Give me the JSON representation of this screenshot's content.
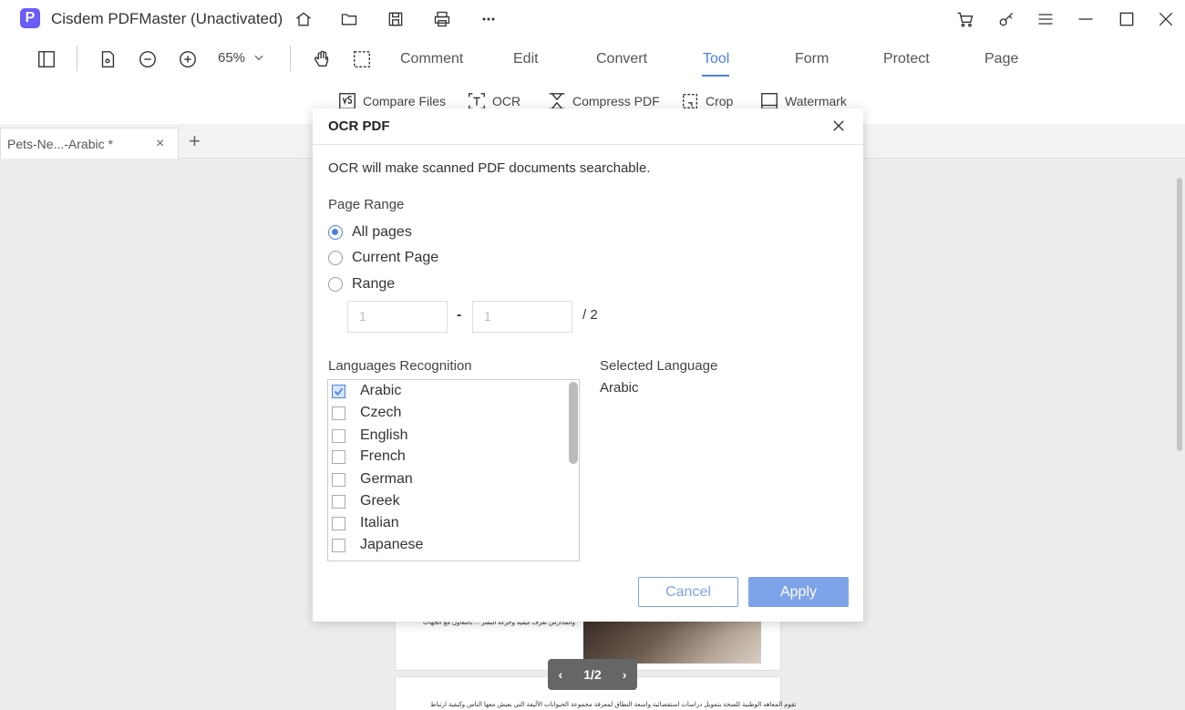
{
  "app": {
    "logo_letter": "P",
    "title": "Cisdem PDFMaster (Unactivated)"
  },
  "toolbar": {
    "zoom": "65%",
    "tabs": [
      {
        "label": "Comment"
      },
      {
        "label": "Edit"
      },
      {
        "label": "Convert"
      },
      {
        "label": "Tool"
      },
      {
        "label": "Form"
      },
      {
        "label": "Protect"
      },
      {
        "label": "Page"
      }
    ],
    "active_tab": "Tool"
  },
  "subtoolbar": {
    "items": [
      {
        "label": "Compare Files"
      },
      {
        "label": "OCR"
      },
      {
        "label": "Compress PDF"
      },
      {
        "label": "Crop"
      },
      {
        "label": "Watermark"
      }
    ]
  },
  "doc_tab": {
    "label": "Pets-Ne...-Arabic *",
    "close": "×",
    "add": "+"
  },
  "pager": {
    "prev": "‹",
    "text": "1/2",
    "next": "›"
  },
  "page_preview": {
    "line1": "والمدارس تعرف كيفية وحركة البشر ... بالتعاون مع الجهات",
    "line2": "تقوم المعاهد الوطنية للصحة بتمويل دراسات استقصائية واسعة النطاق لمعرفة مجموعة الحيوانات الأليفة التي يعيش معها الناس وكيفية ارتباط"
  },
  "dialog": {
    "title": "OCR PDF",
    "description": "OCR will make scanned PDF documents searchable.",
    "page_range_label": "Page Range",
    "options": [
      {
        "label": "All pages",
        "checked": true
      },
      {
        "label": "Current Page",
        "checked": false
      },
      {
        "label": "Range",
        "checked": false
      }
    ],
    "range_from": "1",
    "range_to": "1",
    "range_total": "/  2",
    "range_dash": "-",
    "languages_label": "Languages Recognition",
    "languages": [
      {
        "label": "Arabic",
        "checked": true
      },
      {
        "label": "Czech",
        "checked": false
      },
      {
        "label": "English",
        "checked": false
      },
      {
        "label": "French",
        "checked": false
      },
      {
        "label": "German",
        "checked": false
      },
      {
        "label": "Greek",
        "checked": false
      },
      {
        "label": "Italian",
        "checked": false
      },
      {
        "label": "Japanese",
        "checked": false
      }
    ],
    "selected_language_label": "Selected Language",
    "selected_language": "Arabic",
    "cancel_label": "Cancel",
    "apply_label": "Apply"
  },
  "colors": {
    "accent": "#4a7fe8",
    "button": "#7ea3e9",
    "logo": "#6a5cf5"
  }
}
